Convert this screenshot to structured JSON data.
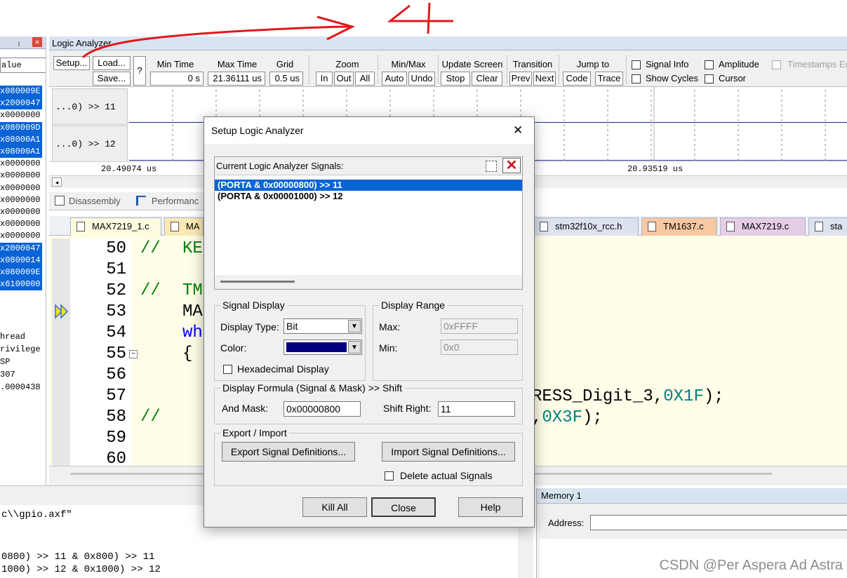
{
  "registers": {
    "header_pin": "ⱼ",
    "header_close": "×",
    "column": "alue",
    "rows": [
      {
        "text": "x080009E",
        "selected": true
      },
      {
        "text": "x2000047",
        "selected": true
      },
      {
        "text": "x0000000",
        "selected": false
      },
      {
        "text": "x080009D",
        "selected": true
      },
      {
        "text": "x08000A1",
        "selected": true
      },
      {
        "text": "x08000A1",
        "selected": true
      },
      {
        "text": "x0000000",
        "selected": false
      },
      {
        "text": "x0000000",
        "selected": false
      },
      {
        "text": "x0000000",
        "selected": false
      },
      {
        "text": "x0000000",
        "selected": false
      },
      {
        "text": "x0000000",
        "selected": false
      },
      {
        "text": "x0000000",
        "selected": false
      },
      {
        "text": "x0000000",
        "selected": false
      },
      {
        "text": "x2000047",
        "selected": true
      },
      {
        "text": "x0800014",
        "selected": true
      },
      {
        "text": "x080009E",
        "selected": true
      },
      {
        "text": "x6100000",
        "selected": true
      }
    ],
    "extra": [
      "hread",
      "rivilege",
      "SP",
      "307",
      ".0000438"
    ]
  },
  "logic_analyzer": {
    "title": "Logic Analyzer",
    "setup": "Setup...",
    "load": "Load...",
    "save": "Save...",
    "help_q": "?",
    "min_time_label": "Min Time",
    "min_time_value": "0 s",
    "max_time_label": "Max Time",
    "max_time_value": "21.36111 us",
    "grid_label": "Grid",
    "grid_value": "0.5 us",
    "zoom_label": "Zoom",
    "zoom_in": "In",
    "zoom_out": "Out",
    "zoom_all": "All",
    "minmax_label": "Min/Max",
    "minmax_auto": "Auto",
    "minmax_undo": "Undo",
    "update_label": "Update Screen",
    "update_stop": "Stop",
    "update_clear": "Clear",
    "transition_label": "Transition",
    "transition_prev": "Prev",
    "transition_next": "Next",
    "jump_label": "Jump to",
    "jump_code": "Code",
    "jump_trace": "Trace",
    "signal_info": "Signal Info",
    "show_cycles": "Show Cycles",
    "amplitude": "Amplitude",
    "cursor": "Cursor",
    "timestamps": "Timestamps En",
    "signals": [
      "...0) >> 11",
      "...0) >> 12"
    ],
    "time_left": "20.49074 us",
    "time_right": "20.93519 us"
  },
  "panel_tabs": [
    "Disassembly",
    "Performanc"
  ],
  "file_tabs": [
    "MAX7219_1.c",
    "MA",
    "stm32f10x_rcc.h",
    "TM1637.c",
    "MAX7219.c",
    "sta"
  ],
  "editor": {
    "line_numbers": [
      "50",
      "51",
      "52",
      "53",
      "54",
      "55",
      "56",
      "57",
      "58",
      "59",
      "60"
    ],
    "lines": [
      {
        "comment": "//",
        "text": "KE"
      },
      {
        "comment": "",
        "text": ""
      },
      {
        "comment": "//",
        "text": "TM"
      },
      {
        "comment": "",
        "text": "MA"
      },
      {
        "comment": "",
        "text": "wh"
      },
      {
        "comment": "",
        "text": "{"
      },
      {
        "comment": "",
        "text": ""
      },
      {
        "comment": "",
        "text": ""
      },
      {
        "comment": "//",
        "text": ""
      },
      {
        "comment": "",
        "text": ""
      },
      {
        "comment": "",
        "text": ""
      }
    ],
    "right_line_57_a": "RESS_Digit_3,",
    "right_line_57_b": "0X1F",
    "right_line_57_c": ");",
    "right_line_58_a": ",",
    "right_line_58_b": "0X3F",
    "right_line_58_c": ");"
  },
  "output": {
    "lines": [
      "c\\\\gpio.axf\"",
      "0800) >> 11 & 0x800) >> 11",
      "1000) >> 12 & 0x1000) >> 12"
    ]
  },
  "memory": {
    "title": "Memory 1",
    "address_label": "Address:"
  },
  "dialog": {
    "title": "Setup Logic Analyzer",
    "close_glyph": "✕",
    "signals_label": "Current Logic Analyzer Signals:",
    "signals": [
      "(PORTA & 0x00000800) >> 11",
      "(PORTA & 0x00001000) >> 12"
    ],
    "signal_display_group": "Signal Display",
    "display_type_label": "Display Type:",
    "display_type_value": "Bit",
    "color_label": "Color:",
    "color_value": "#000080",
    "hex_display": "Hexadecimal Display",
    "display_range_group": "Display Range",
    "max_label": "Max:",
    "max_value": "0xFFFF",
    "min_label": "Min:",
    "min_value": "0x0",
    "formula_group": "Display Formula (Signal & Mask) >> Shift",
    "and_mask_label": "And Mask:",
    "and_mask_value": "0x00000800",
    "shift_right_label": "Shift Right:",
    "shift_right_value": "11",
    "export_import_group": "Export / Import",
    "export_btn": "Export Signal Definitions...",
    "import_btn": "Import Signal Definitions...",
    "delete_actual": "Delete actual Signals",
    "kill_all": "Kill All",
    "close": "Close",
    "help": "Help"
  },
  "annotation": {
    "color": "#e0191b",
    "mark": "4"
  },
  "watermark": "CSDN @Per  Aspera Ad Astra"
}
